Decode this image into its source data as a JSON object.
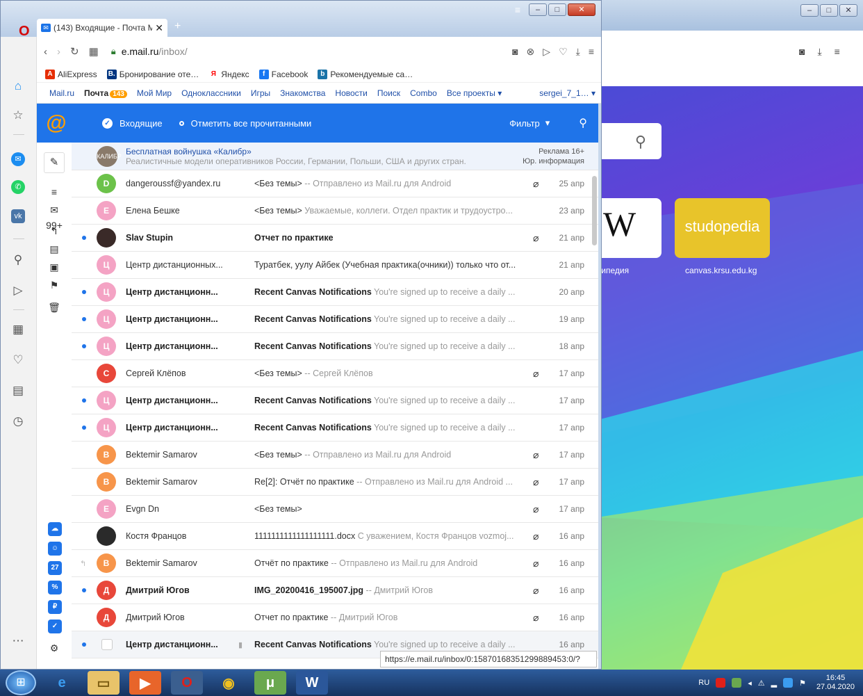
{
  "window": {
    "tab_title": "(143) Входящие - Почта М",
    "tab_close": "✕",
    "url_domain": "e.mail.ru",
    "url_path": "/inbox/"
  },
  "bookmarks": [
    {
      "label": "AliExpress",
      "color": "#e62e04",
      "glyph": "A"
    },
    {
      "label": "Бронирование оте…",
      "color": "#003580",
      "glyph": "B."
    },
    {
      "label": "Яндекс",
      "color": "#ffffff",
      "glyph": "Я"
    },
    {
      "label": "Facebook",
      "color": "#1877f2",
      "glyph": "f"
    },
    {
      "label": "Рекомендуемые са…",
      "color": "#1a73a8",
      "glyph": "b"
    }
  ],
  "portal": {
    "links": [
      "Mail.ru",
      "Почта",
      "Мой Мир",
      "Одноклассники",
      "Игры",
      "Знакомства",
      "Новости",
      "Поиск",
      "Combo",
      "Все проекты ▾"
    ],
    "mail_badge": "143",
    "user": "sergei_7_1…"
  },
  "mail_header": {
    "folder": "Входящие",
    "mark_all": "Отметить все прочитанными",
    "filter": "Фильтр"
  },
  "toolbar": {
    "unread_count": "99+",
    "calendar_day": "27"
  },
  "ad": {
    "title": "Бесплатная войнушка «Калибр»",
    "text": "Реалистичные модели оперативников России, Германии, Польши, США и других стран.",
    "label": "Реклама 16+",
    "legal": "Юр. информация",
    "avatar": "КАЛИБР"
  },
  "emails": [
    {
      "letter": "D",
      "avatar_color": "#6cc24a",
      "from": "dangeroussf@yandex.ru",
      "subject": "<Без темы>",
      "snippet": " -- Отправлено из Mail.ru для Android",
      "attach": true,
      "date": "25 апр",
      "unread": false
    },
    {
      "letter": "Е",
      "avatar_color": "#f4a3c4",
      "from": "Елена Бешке",
      "subject": "<Без темы>",
      "snippet": " Уважаемые, коллеги. Отдел практик и трудоустро...",
      "attach": false,
      "date": "23 апр",
      "unread": false
    },
    {
      "letter": "",
      "avatar_color": "#3a2a28",
      "from": "Slav Stupin",
      "subject": "Отчет по практике",
      "snippet": "",
      "attach": true,
      "date": "21 апр",
      "unread": true
    },
    {
      "letter": "Ц",
      "avatar_color": "#f4a3c4",
      "from": "Центр дистанционных...",
      "subject": "Туратбек, уулу Айбек (Учебная практика(очники)) только что от...",
      "snippet": "",
      "attach": false,
      "date": "21 апр",
      "unread": false
    },
    {
      "letter": "Ц",
      "avatar_color": "#f4a3c4",
      "from": "Центр дистанционн...",
      "subject": "Recent Canvas Notifications",
      "snippet": " You're signed up to receive a daily ...",
      "attach": false,
      "date": "20 апр",
      "unread": true
    },
    {
      "letter": "Ц",
      "avatar_color": "#f4a3c4",
      "from": "Центр дистанционн...",
      "subject": "Recent Canvas Notifications",
      "snippet": " You're signed up to receive a daily ...",
      "attach": false,
      "date": "19 апр",
      "unread": true
    },
    {
      "letter": "Ц",
      "avatar_color": "#f4a3c4",
      "from": "Центр дистанционн...",
      "subject": "Recent Canvas Notifications",
      "snippet": " You're signed up to receive a daily ...",
      "attach": false,
      "date": "18 апр",
      "unread": true
    },
    {
      "letter": "С",
      "avatar_color": "#e8473a",
      "from": "Сергей Клёпов",
      "subject": "<Без темы>",
      "snippet": " -- Сергей Клёпов",
      "attach": true,
      "date": "17 апр",
      "unread": false
    },
    {
      "letter": "Ц",
      "avatar_color": "#f4a3c4",
      "from": "Центр дистанционн...",
      "subject": "Recent Canvas Notifications",
      "snippet": " You're signed up to receive a daily ...",
      "attach": false,
      "date": "17 апр",
      "unread": true
    },
    {
      "letter": "Ц",
      "avatar_color": "#f4a3c4",
      "from": "Центр дистанционн...",
      "subject": "Recent Canvas Notifications",
      "snippet": " You're signed up to receive a daily ...",
      "attach": false,
      "date": "17 апр",
      "unread": true
    },
    {
      "letter": "B",
      "avatar_color": "#f7954a",
      "from": "Bektemir Samarov",
      "subject": "<Без темы>",
      "snippet": " -- Отправлено из Mail.ru для Android",
      "attach": true,
      "date": "17 апр",
      "unread": false
    },
    {
      "letter": "B",
      "avatar_color": "#f7954a",
      "from": "Bektemir Samarov",
      "subject": "Re[2]: Отчёт по практике",
      "snippet": " -- Отправлено из Mail.ru для Android ...",
      "attach": true,
      "date": "17 апр",
      "unread": false
    },
    {
      "letter": "E",
      "avatar_color": "#f4a3c4",
      "from": "Evgn Dn",
      "subject": "<Без темы>",
      "snippet": "",
      "attach": true,
      "date": "17 апр",
      "unread": false
    },
    {
      "letter": "",
      "avatar_color": "#2a2a2a",
      "from": "Костя Францов",
      "subject": "1111111111111111111.docx",
      "snippet": " С уважением, Костя Францов vozmoj...",
      "attach": true,
      "date": "16 апр",
      "unread": false
    },
    {
      "letter": "B",
      "avatar_color": "#f7954a",
      "from": "Bektemir Samarov",
      "subject": "Отчёт по практике",
      "snippet": " -- Отправлено из Mail.ru для Android",
      "attach": true,
      "date": "16 апр",
      "unread": false,
      "replied": true
    },
    {
      "letter": "Д",
      "avatar_color": "#e8473a",
      "from": "Дмитрий Югов",
      "subject": "IMG_20200416_195007.jpg",
      "snippet": " -- Дмитрий Югов",
      "attach": true,
      "date": "16 апр",
      "unread": true
    },
    {
      "letter": "Д",
      "avatar_color": "#e8473a",
      "from": "Дмитрий Югов",
      "subject": "Отчет по практике",
      "snippet": " -- Дмитрий Югов",
      "attach": true,
      "date": "16 апр",
      "unread": false
    },
    {
      "letter": "",
      "avatar_color": "",
      "from": "Центр дистанционн...",
      "subject": "Recent Canvas Notifications",
      "snippet": " You're signed up to receive a daily ...",
      "attach": false,
      "date": "16 апр",
      "unread": true,
      "selected": true
    }
  ],
  "status_url": "https://e.mail.ru/inbox/0:15870168351299889453:0/?",
  "background_page": {
    "tile1_label": "кипедия",
    "tile2_label": "canvas.krsu.edu.kg",
    "tile2_text": "studopedia",
    "tile1_text": "W"
  },
  "taskbar": {
    "lang": "RU",
    "time": "16:45",
    "date": "27.04.2020"
  }
}
